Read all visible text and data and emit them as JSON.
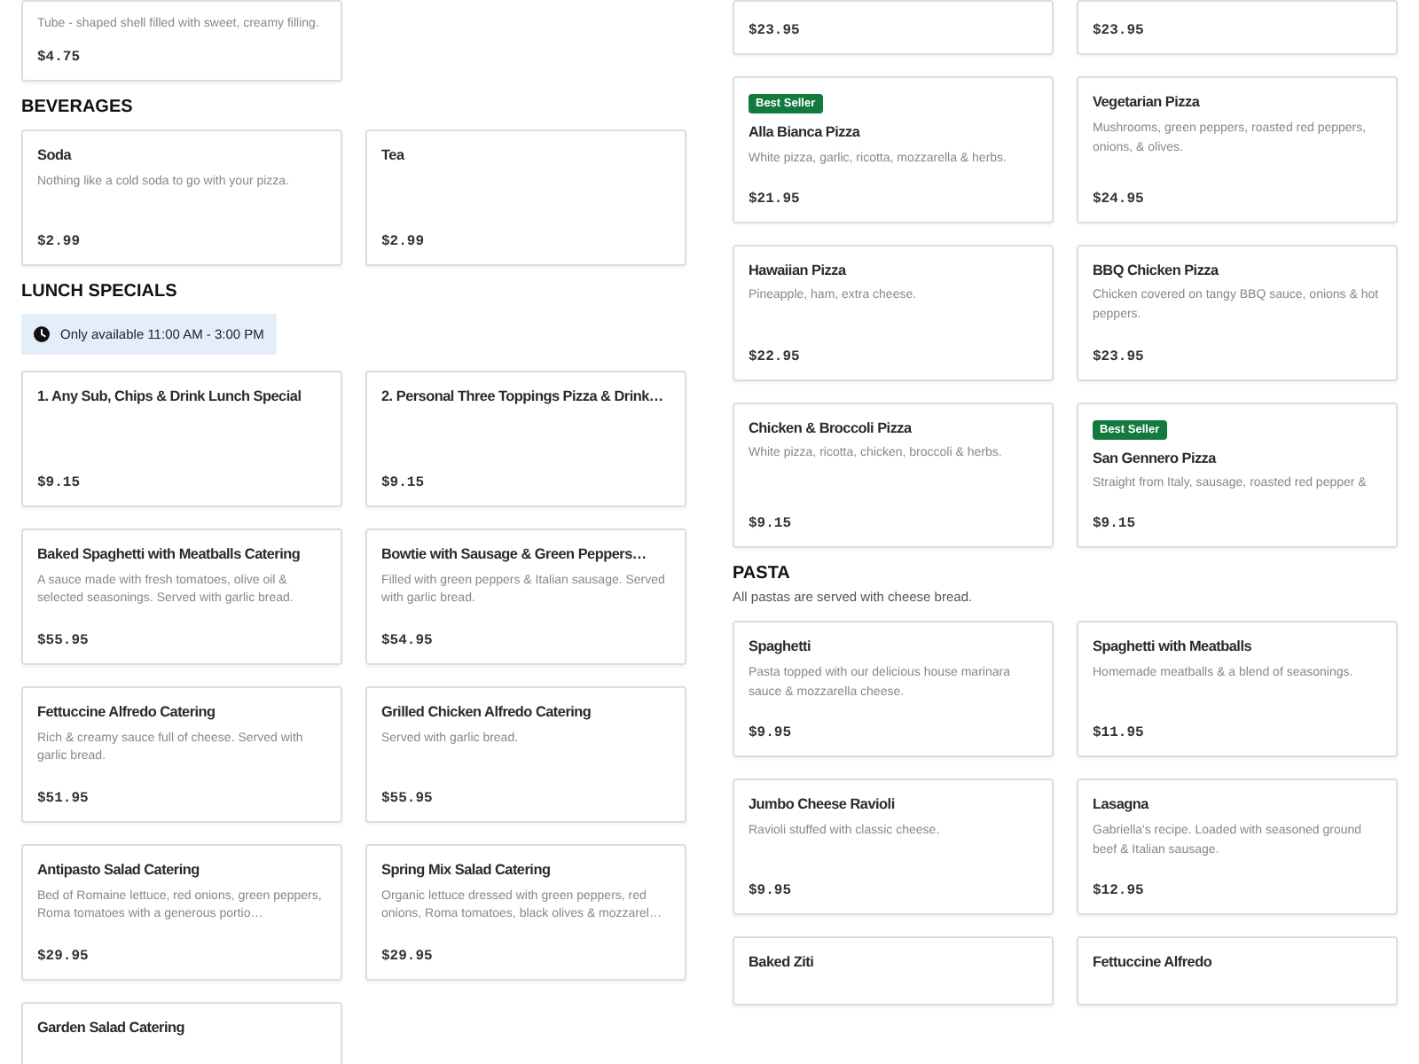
{
  "columns": [
    {
      "sections": [
        {
          "items": [
            {
              "description": "Tube - shaped shell filled with sweet, creamy filling.",
              "price": "$4.75"
            }
          ]
        },
        {
          "heading": "BEVERAGES",
          "items": [
            {
              "title": "Soda",
              "description": "Nothing like a cold soda to go with your pizza.",
              "price": "$2.99"
            },
            {
              "title": "Tea",
              "price": "$2.99"
            }
          ]
        },
        {
          "heading": "LUNCH SPECIALS",
          "notice": "Only available 11:00 AM - 3:00 PM",
          "items": [
            {
              "title": "1. Any Sub, Chips & Drink Lunch Special",
              "price": "$9.15"
            },
            {
              "title": "2. Personal Three Toppings Pizza & Drink…",
              "price": "$9.15"
            },
            {
              "title": "Baked Spaghetti with Meatballs Catering",
              "description": "A sauce made with fresh tomatoes, olive oil & selected seasonings. Served with garlic bread.",
              "price": "$55.95"
            },
            {
              "title": "Bowtie with Sausage & Green Peppers…",
              "description": "Filled with green peppers & Italian sausage. Served with garlic bread.",
              "price": "$54.95"
            },
            {
              "title": "Fettuccine Alfredo Catering",
              "description": "Rich & creamy sauce full of cheese. Served with garlic bread.",
              "price": "$51.95"
            },
            {
              "title": "Grilled Chicken Alfredo Catering",
              "description": "Served with garlic bread.",
              "price": "$55.95"
            },
            {
              "title": "Antipasto Salad Catering",
              "description": "Bed of Romaine lettuce, red onions, green peppers, Roma tomatoes with a generous portio…",
              "price": "$29.95"
            },
            {
              "title": "Spring Mix Salad Catering",
              "description": "Organic lettuce dressed with green peppers, red onions, Roma tomatoes, black olives & mozzarel…",
              "price": "$29.95"
            },
            {
              "title": "Garden Salad Catering"
            }
          ]
        }
      ]
    },
    {
      "sections": [
        {
          "items": [
            {
              "price": "$23.95"
            },
            {
              "price": "$23.95"
            },
            {
              "badge": "Best Seller",
              "title": "Alla Bianca Pizza",
              "description": "White pizza, garlic, ricotta, mozzarella & herbs.",
              "price": "$21.95"
            },
            {
              "title": "Vegetarian Pizza",
              "description": "Mushrooms, green peppers, roasted red peppers, onions, & olives.",
              "price": "$24.95"
            },
            {
              "title": "Hawaiian Pizza",
              "description": "Pineapple, ham, extra cheese.",
              "price": "$22.95"
            },
            {
              "title": "BBQ Chicken Pizza",
              "description": "Chicken covered on tangy BBQ sauce, onions & hot peppers.",
              "price": "$23.95"
            },
            {
              "title": "Chicken & Broccoli Pizza",
              "description": "White pizza, ricotta, chicken, broccoli & herbs.",
              "price": "$9.15"
            },
            {
              "badge": "Best Seller",
              "title": "San Gennero Pizza",
              "description": "Straight from Italy, sausage, roasted red pepper &",
              "price": "$9.15"
            }
          ]
        },
        {
          "heading": "PASTA",
          "note": "All pastas are served with cheese bread.",
          "items": [
            {
              "title": "Spaghetti",
              "description": "Pasta topped with our delicious house marinara sauce & mozzarella cheese.",
              "price": "$9.95"
            },
            {
              "title": "Spaghetti with Meatballs",
              "description": "Homemade meatballs & a blend of seasonings.",
              "price": "$11.95"
            },
            {
              "title": "Jumbo Cheese Ravioli",
              "description": "Ravioli stuffed with classic cheese.",
              "price": "$9.95"
            },
            {
              "title": "Lasagna",
              "description": "Gabriella's recipe. Loaded with seasoned ground beef & Italian sausage.",
              "price": "$12.95"
            },
            {
              "title": "Baked Ziti"
            },
            {
              "title": "Fettuccine Alfredo"
            }
          ]
        }
      ]
    }
  ]
}
